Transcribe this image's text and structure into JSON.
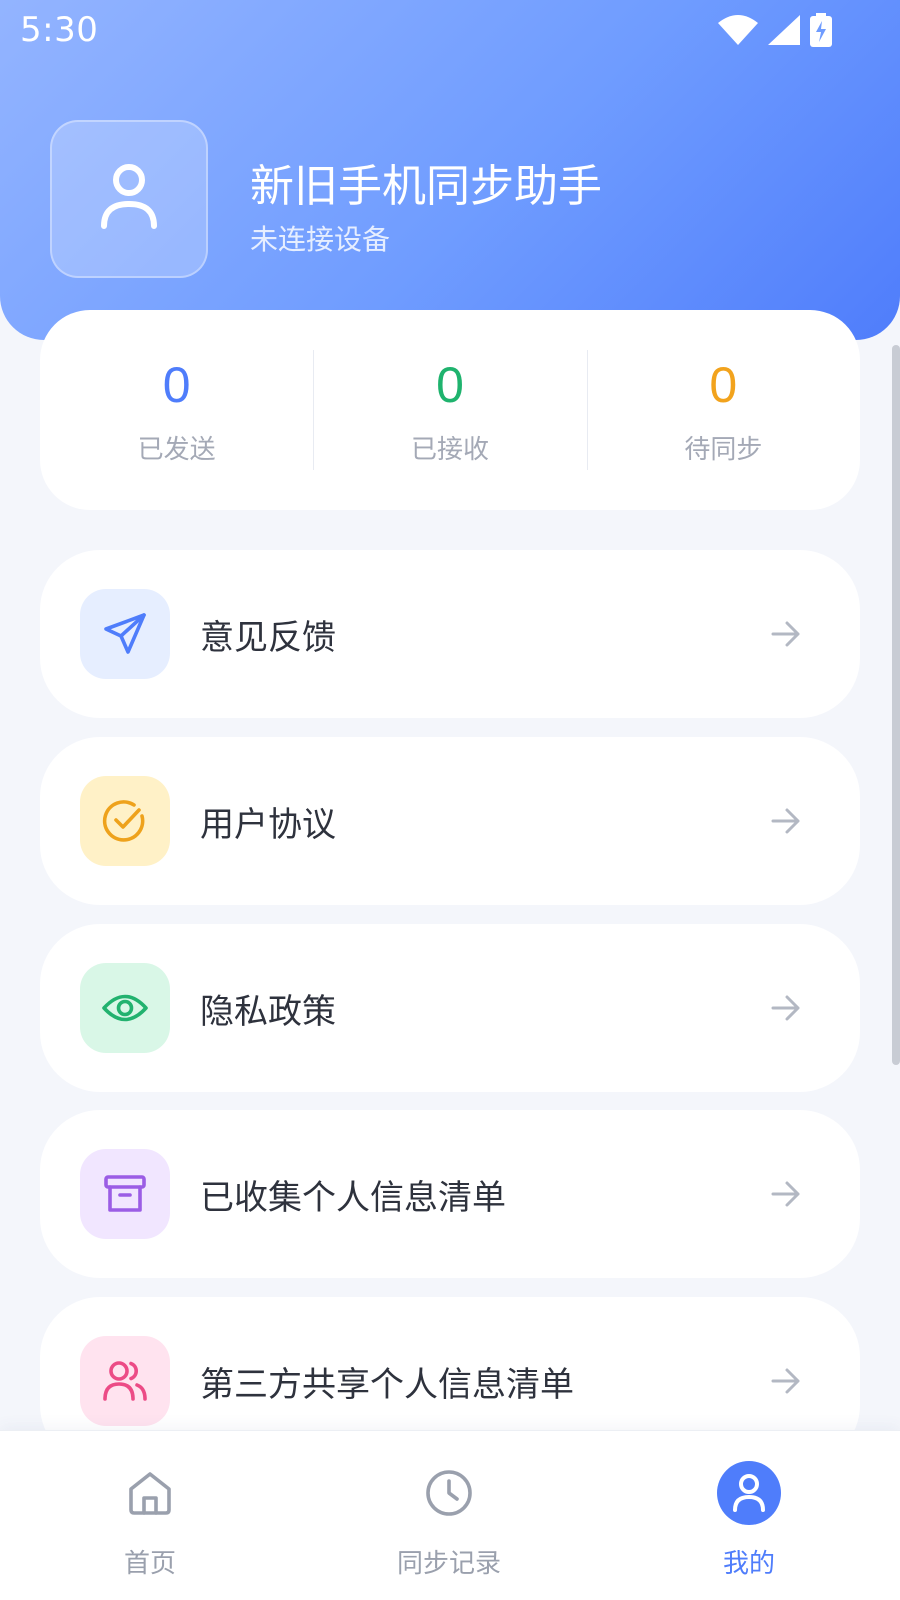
{
  "status_bar": {
    "time": "5:30",
    "icons": [
      "wifi-icon",
      "signal-icon",
      "battery-charging-icon"
    ]
  },
  "profile": {
    "avatar_icon": "user-icon",
    "app_name": "新旧手机同步助手",
    "connection_status": "未连接设备"
  },
  "stats": [
    {
      "value": "0",
      "label": "已发送",
      "color": "#4f7dfb"
    },
    {
      "value": "0",
      "label": "已接收",
      "color": "#1fb36e"
    },
    {
      "value": "0",
      "label": "待同步",
      "color": "#f2a31d"
    }
  ],
  "menu": [
    {
      "label": "意见反馈",
      "icon": "send-icon",
      "icon_bg": "#e6eeff",
      "icon_color": "#4f7dfb"
    },
    {
      "label": "用户协议",
      "icon": "check-circle-icon",
      "icon_bg": "#fff1c7",
      "icon_color": "#eea21c"
    },
    {
      "label": "隐私政策",
      "icon": "eye-icon",
      "icon_bg": "#d9f7e7",
      "icon_color": "#22b26f"
    },
    {
      "label": "已收集个人信息清单",
      "icon": "archive-icon",
      "icon_bg": "#f1e6ff",
      "icon_color": "#9b5de5"
    },
    {
      "label": "第三方共享个人信息清单",
      "icon": "users-icon",
      "icon_bg": "#ffe3ef",
      "icon_color": "#ec4b86"
    }
  ],
  "bottom_nav": [
    {
      "label": "首页",
      "icon": "home-icon",
      "active": false
    },
    {
      "label": "同步记录",
      "icon": "clock-icon",
      "active": false
    },
    {
      "label": "我的",
      "icon": "user-icon",
      "active": true
    }
  ],
  "colors": {
    "accent": "#4f7dfb",
    "page_bg": "#f4f6fb"
  }
}
